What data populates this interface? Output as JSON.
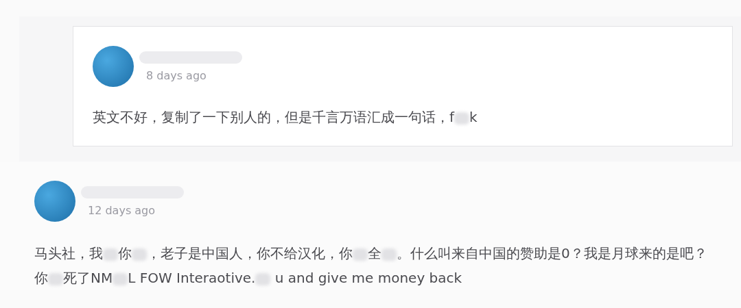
{
  "comments": [
    {
      "nested": true,
      "time": "8 days ago",
      "body": [
        {
          "kind": "text",
          "text": "英文不好，复制了一下别人的，但是千言万语汇成一句话，f"
        },
        {
          "kind": "blur"
        },
        {
          "kind": "text",
          "text": "k"
        }
      ]
    },
    {
      "nested": false,
      "time": "12 days ago",
      "body": [
        {
          "kind": "text",
          "text": "马头社，我"
        },
        {
          "kind": "blur"
        },
        {
          "kind": "text",
          "text": "你"
        },
        {
          "kind": "blur"
        },
        {
          "kind": "text",
          "text": "，老子是中国人，你不给汉化，你"
        },
        {
          "kind": "blur"
        },
        {
          "kind": "text",
          "text": "全"
        },
        {
          "kind": "blur"
        },
        {
          "kind": "text",
          "text": "。什么叫来自中国的赞助是0？我是月球来的是吧？你"
        },
        {
          "kind": "blur"
        },
        {
          "kind": "text",
          "text": "死了NM"
        },
        {
          "kind": "blur"
        },
        {
          "kind": "text",
          "text": "L FOW Interaotive."
        },
        {
          "kind": "blur"
        },
        {
          "kind": "text",
          "text": " u and give me money back"
        }
      ]
    }
  ]
}
